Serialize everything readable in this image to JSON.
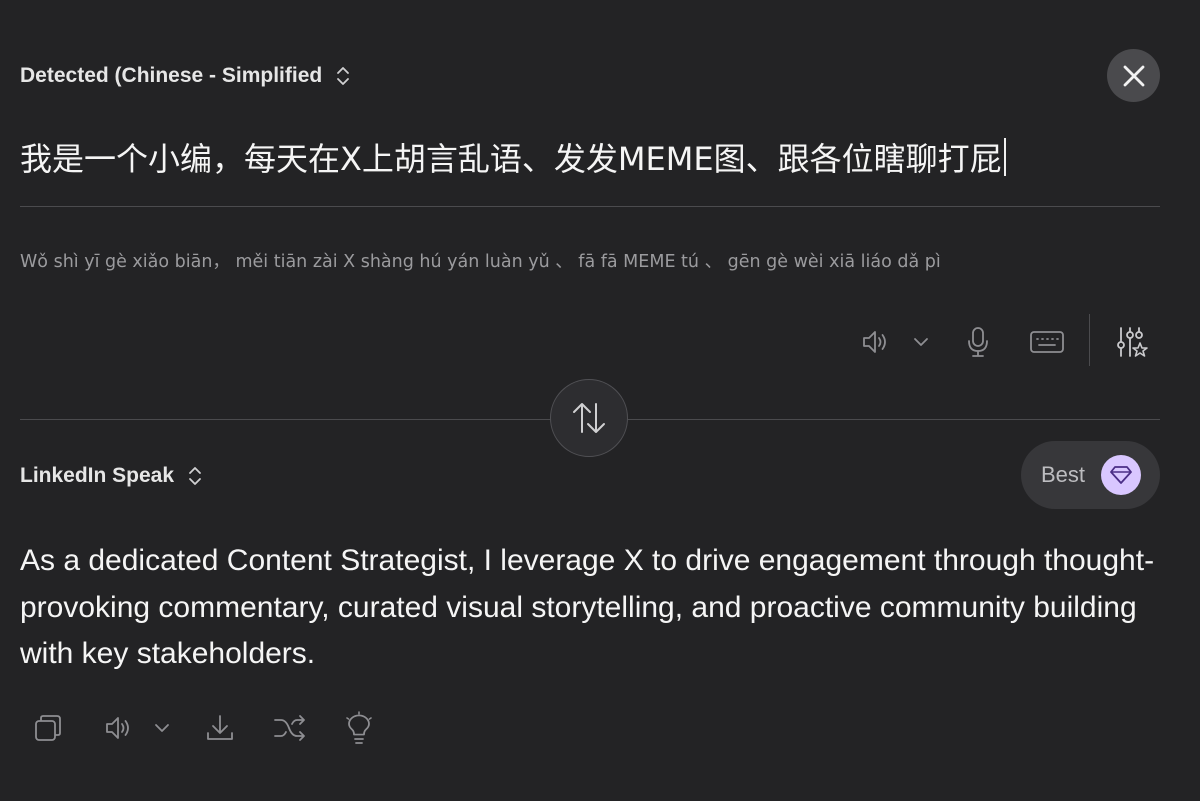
{
  "source": {
    "language_label": "Detected (Chinese - Simplified",
    "text": "我是一个小编，每天在X上胡言乱语、发发MEME图、跟各位瞎聊打屁",
    "pinyin": "Wǒ shì yī gè xiǎo biān，  měi tiān zài X shàng hú yán luàn yǔ  、  fā fā MEME tú  、  gēn gè wèi xiā liáo dǎ pì",
    "toolbar_icons": [
      "speaker-icon",
      "chevron-down-icon",
      "microphone-icon",
      "keyboard-icon",
      "sliders-star-icon"
    ]
  },
  "target": {
    "language_label": "LinkedIn Speak",
    "mode_label": "Best",
    "text": "As a dedicated Content Strategist, I leverage X to drive engagement through thought-provoking commentary, curated visual storytelling, and proactive community building with key stakeholders.",
    "toolbar_icons": [
      "copy-icon",
      "speaker-icon",
      "chevron-down-icon",
      "download-icon",
      "shuffle-icon",
      "lightbulb-icon"
    ]
  },
  "colors": {
    "background": "#232325",
    "accent_gem": "#d9c7ff",
    "icon": "#8e8e92"
  }
}
